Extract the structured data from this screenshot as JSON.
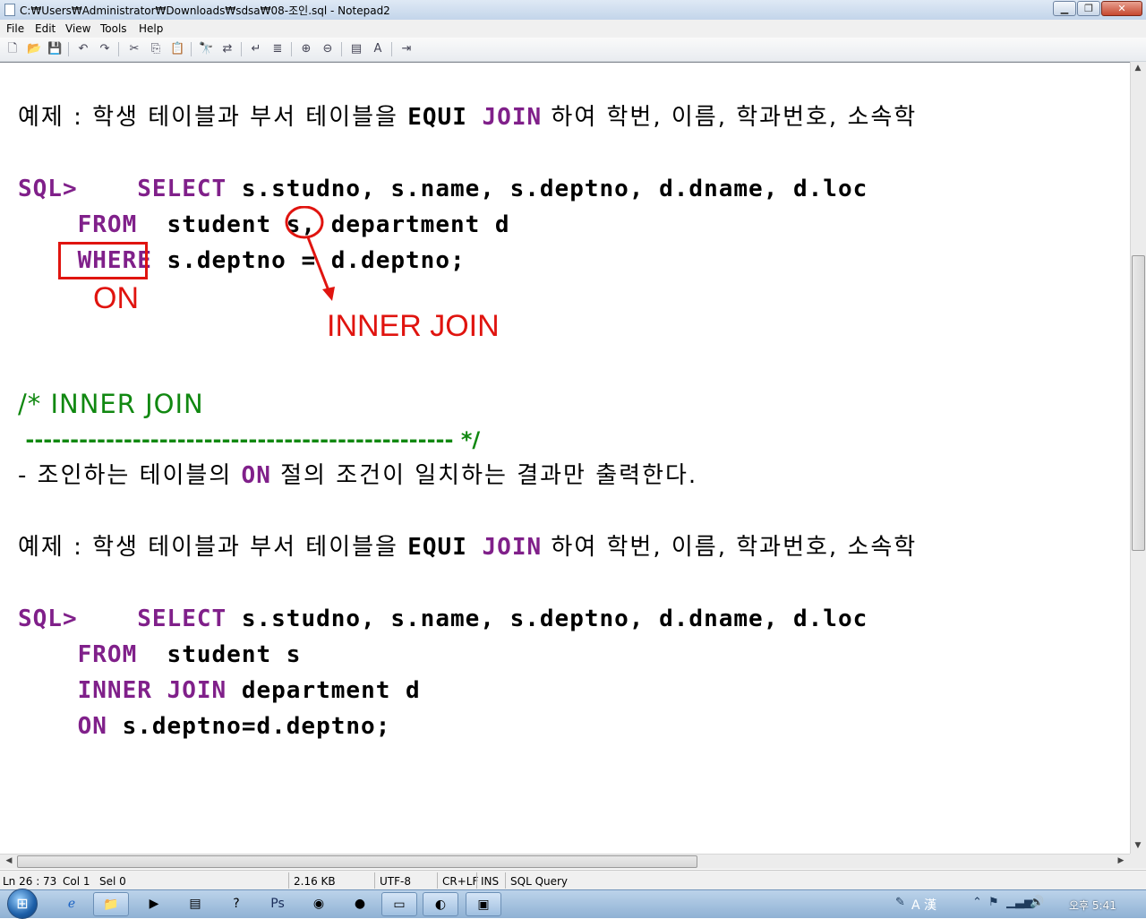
{
  "window": {
    "title": "C:₩Users₩Administrator₩Downloads₩sdsa₩08-조인.sql - Notepad2",
    "minimize_icon": "minimize-icon",
    "maximize_icon": "restore-icon",
    "close_icon": "close-icon"
  },
  "menu": [
    "File",
    "Edit",
    "View",
    "Tools",
    "Help"
  ],
  "toolbar_icons": [
    "new-file-icon",
    "open-file-icon",
    "save-icon",
    "undo-icon",
    "redo-icon",
    "cut-icon",
    "copy-icon",
    "paste-icon",
    "find-icon",
    "replace-icon",
    "wordwrap-icon",
    "line-numbers-icon",
    "zoom-in-icon",
    "zoom-out-icon",
    "scheme-icon",
    "font-icon",
    "exit-icon"
  ],
  "editor": {
    "example1": "예제 : 학생 테이블과 부서 테이블을 ",
    "example_tail": " 하여 학번, 이름, 학과번호, 소속학",
    "kw_equi": "EQUI",
    "kw_join": "JOIN",
    "sql_prompt": "SQL>",
    "kw_select": "SELECT",
    "select_cols": " s.studno, s.name, s.deptno, d.dname, d.loc",
    "kw_from": "FROM",
    "from_clause1": "  student s, department d",
    "kw_where": "WHERE",
    "where_clause": " s.deptno = d.deptno;",
    "comment_title": "/* INNER JOIN",
    "comment_rule": " ------------------------------------------------ */",
    "desc_prefix": "- 조인하는 테이블의 ",
    "kw_on": "ON",
    "desc_suffix": " 절의 조건이 일치하는 결과만 출력한다.",
    "from_clause2": "  student s",
    "kw_inner": "INNER",
    "join_table": " department d",
    "on_clause": " s.deptno=d.deptno;"
  },
  "annotations": {
    "on_label": "ON",
    "inner_join_label": "INNER JOIN",
    "color": "#e0140f"
  },
  "statusbar": {
    "position": "Ln 26 : 73",
    "col": "Col 1",
    "sel": "Sel 0",
    "size": "2.16 KB",
    "encoding": "UTF-8",
    "eol": "CR+LF",
    "mode": "INS",
    "scheme": "SQL Query"
  },
  "taskbar": {
    "tray_ime": "A 漢",
    "clock": "오후 5:41"
  }
}
